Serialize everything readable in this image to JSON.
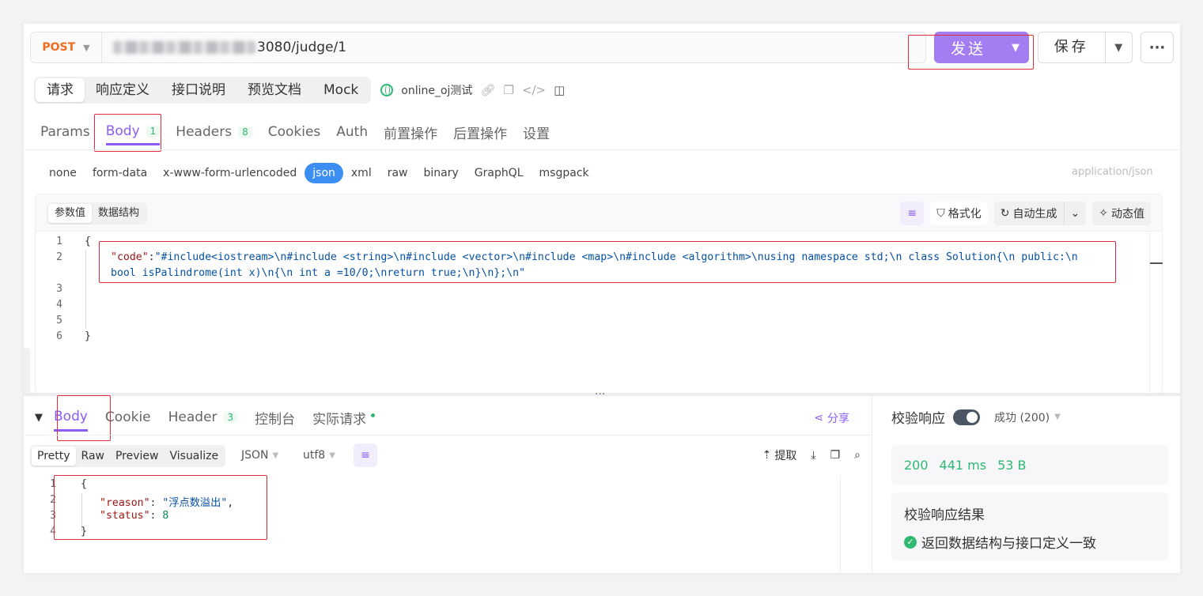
{
  "request": {
    "method": "POST",
    "url_suffix": "3080/judge/1",
    "send_label": "发送",
    "save_label": "保存"
  },
  "top_tabs": [
    "请求",
    "响应定义",
    "接口说明",
    "预览文档",
    "Mock"
  ],
  "environment": "online_oj测试",
  "param_tabs": [
    {
      "label": "Params"
    },
    {
      "label": "Body",
      "badge": "1"
    },
    {
      "label": "Headers",
      "badge": "8"
    },
    {
      "label": "Cookies"
    },
    {
      "label": "Auth"
    },
    {
      "label": "前置操作"
    },
    {
      "label": "后置操作"
    },
    {
      "label": "设置"
    }
  ],
  "body_types": [
    "none",
    "form-data",
    "x-www-form-urlencoded",
    "json",
    "xml",
    "raw",
    "binary",
    "GraphQL",
    "msgpack"
  ],
  "active_body_type": "json",
  "content_type": "application/json",
  "editor": {
    "modes": [
      "参数值",
      "数据结构"
    ],
    "format_label": "格式化",
    "autogen_label": "自动生成",
    "dynamic_label": "动态值",
    "lines": [
      "1",
      "2",
      "",
      "3",
      "4",
      "5",
      "6"
    ],
    "code_open": "{",
    "code_key": "\"code\"",
    "code_colon": ":",
    "code_value_line1": "\"#include<iostream>\\n#include <string>\\n#include <vector>\\n#include <map>\\n#include <algorithm>\\nusing namespace std;\\n class Solution{\\n public:\\n",
    "code_value_line2": "bool isPalindrome(int x)\\n{\\n int a =10/0;\\nreturn true;\\n}\\n};\\n\"",
    "code_close": "}"
  },
  "response": {
    "tabs": [
      {
        "label": "Body"
      },
      {
        "label": "Cookie"
      },
      {
        "label": "Header",
        "badge": "3"
      },
      {
        "label": "控制台"
      },
      {
        "label": "实际请求"
      }
    ],
    "share_label": "分享",
    "view_modes": [
      "Pretty",
      "Raw",
      "Preview",
      "Visualize"
    ],
    "format": "JSON",
    "encoding": "utf8",
    "extract_label": "提取",
    "lines": [
      "1",
      "2",
      "3",
      "4"
    ],
    "open": "{",
    "reason_key": "\"reason\"",
    "reason_value": "\"浮点数溢出\"",
    "status_key": "\"status\"",
    "status_value": "8",
    "close": "}"
  },
  "validation": {
    "title": "校验响应",
    "status_option": "成功 (200)",
    "code": "200",
    "time": "441 ms",
    "size": "53 B",
    "result_title": "校验响应结果",
    "result_message": "返回数据结构与接口定义一致"
  }
}
